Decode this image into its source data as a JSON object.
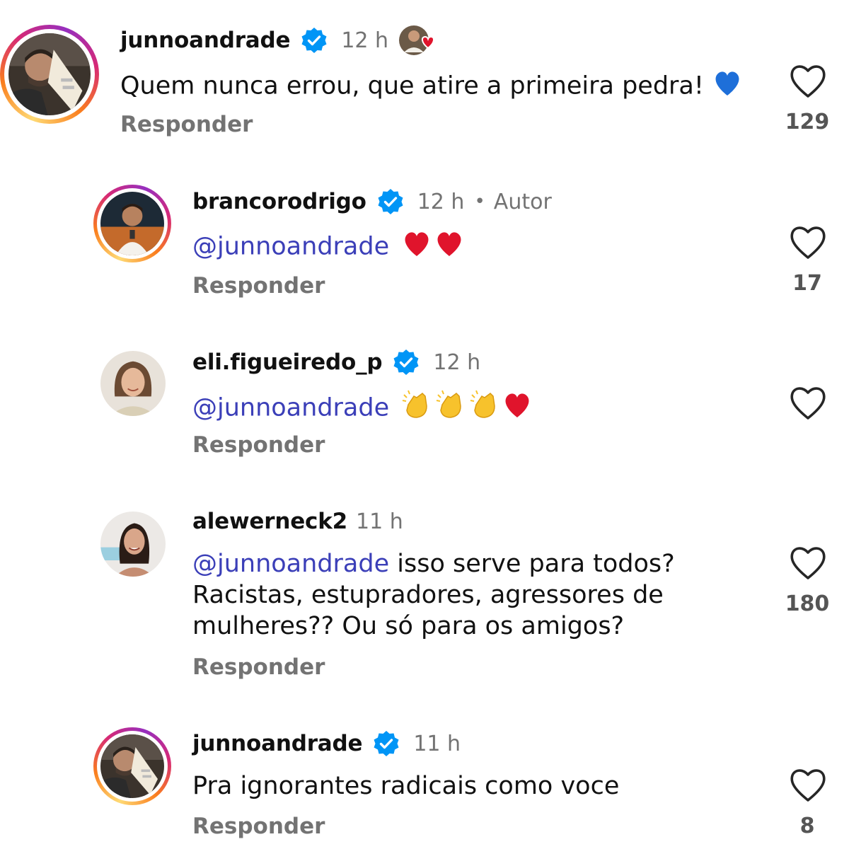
{
  "colors": {
    "mention": "#3b3fb8",
    "muted": "#737373",
    "verified": "#0095f6",
    "heart_red": "#e0142c",
    "heart_blue": "#1e6fd9"
  },
  "icons": {
    "verified": "verified-badge-icon",
    "like": "heart-outline-icon",
    "liked_by_author": "author-liked-heart-icon"
  },
  "comments": [
    {
      "username": "junnoandrade",
      "verified": true,
      "time": "12 h",
      "text": "Quem nunca errou, que atire a primeira pedra!",
      "text_emoji": "blue-heart",
      "reply_label": "Responder",
      "likes": "129"
    },
    {
      "username": "brancorodrigo",
      "verified": true,
      "time": "12 h",
      "dot": "•",
      "author_label": "Autor",
      "mention": "@junnoandrade",
      "text_emoji": "two-red-hearts",
      "reply_label": "Responder",
      "likes": "17"
    },
    {
      "username": "eli.figueiredo_p",
      "verified": true,
      "time": "12 h",
      "mention": "@junnoandrade",
      "text_emoji": "three-clapping-hands-red-heart",
      "reply_label": "Responder"
    },
    {
      "username": "alewerneck2",
      "verified": false,
      "time": "11 h",
      "mention": "@junnoandrade",
      "text_line1": "isso serve para todos?",
      "text_line2": "Racistas, estupradores, agressores de",
      "text_line3": "mulheres?? Ou só para os amigos?",
      "reply_label": "Responder",
      "likes": "180"
    },
    {
      "username": "junnoandrade",
      "verified": true,
      "time": "11 h",
      "text": "Pra ignorantes radicais como voce",
      "reply_label": "Responder",
      "likes": "8"
    }
  ]
}
